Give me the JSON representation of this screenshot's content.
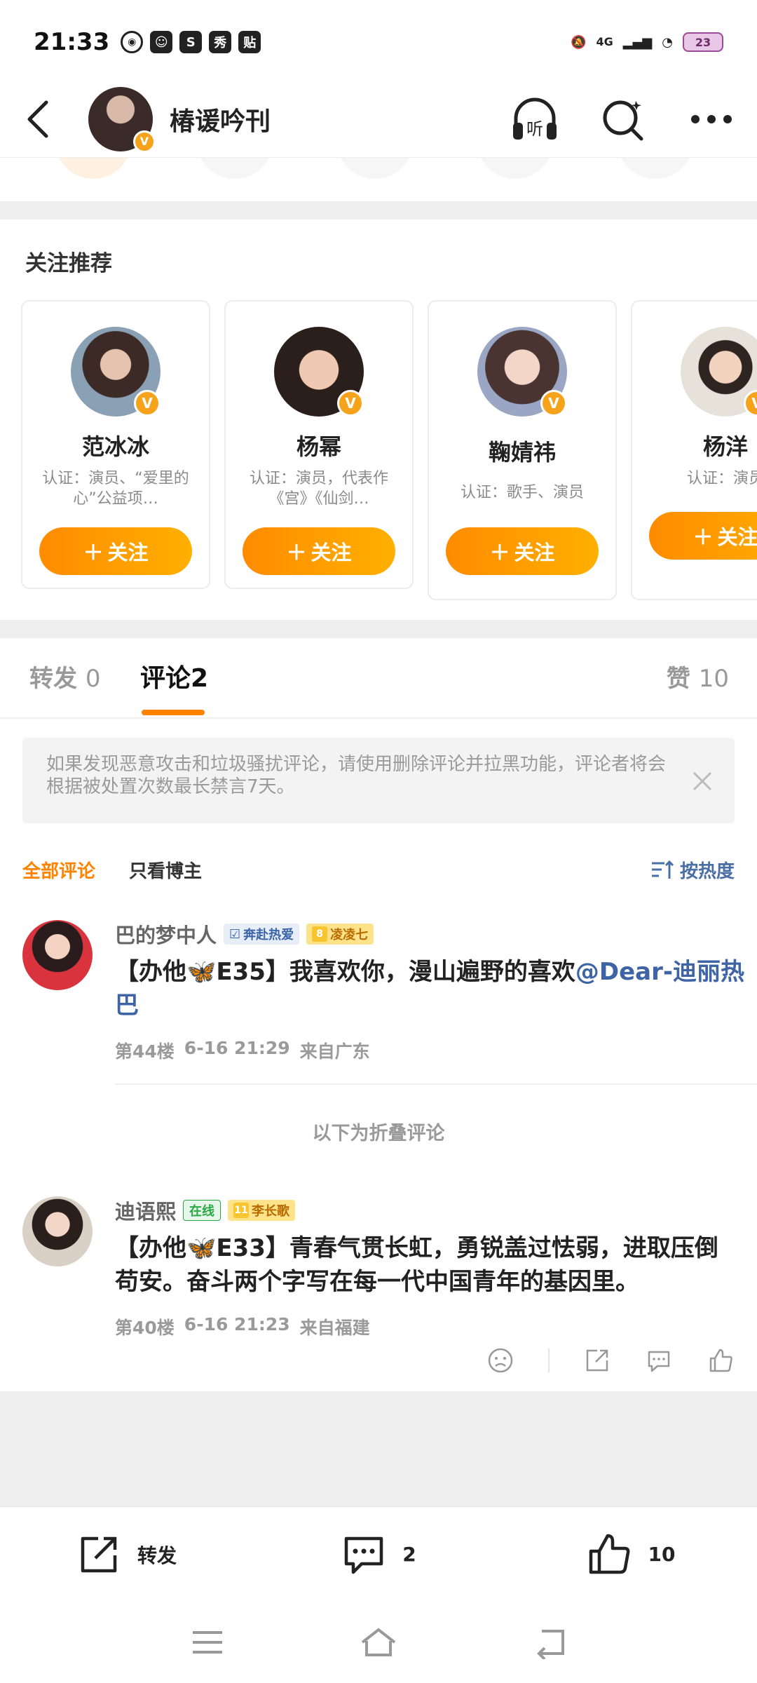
{
  "status_bar": {
    "time": "21:33",
    "app_icons": [
      "weibo-icon",
      "emoji-icon",
      "s-icon",
      "秀",
      "贴"
    ],
    "app_labels": {
      "xiu": "秀",
      "tie": "贴"
    },
    "network": "4G",
    "battery": "23"
  },
  "header": {
    "title": "椿谖吟刊",
    "listen_label": "听"
  },
  "recommend": {
    "title": "关注推荐",
    "follow_label": "关注",
    "cards": [
      {
        "name": "范冰冰",
        "desc": "认证：演员、“爱里的心”公益项…"
      },
      {
        "name": "杨幂",
        "desc": "认证：演员，代表作《宫》《仙剑…"
      },
      {
        "name": "鞠婧祎",
        "desc": "认证：歌手、演员"
      },
      {
        "name": "杨洋",
        "desc": "认证：演员"
      }
    ]
  },
  "tabs": {
    "repost": {
      "label": "转发",
      "count": "0"
    },
    "comment": {
      "label": "评论",
      "count": "2"
    },
    "like": {
      "label": "赞",
      "count": "10"
    }
  },
  "notice": {
    "text": "如果发现恶意攻击和垃圾骚扰评论，请使用删除评论并拉黑功能，评论者将会根据被处置次数最长禁言7天。"
  },
  "filters": {
    "all": "全部评论",
    "blogger_only": "只看博主",
    "sort": "按热度"
  },
  "comments": [
    {
      "user": "巴的梦中人",
      "tag1": "奔赴热爱",
      "tag2_level": "8",
      "tag2": "凌凌七",
      "text": "【办他🦋E35】我喜欢你，漫山遍野的喜欢",
      "mention": "@Dear-迪丽热巴",
      "floor": "第44楼",
      "time": "6-16 21:29",
      "location": "来自广东"
    },
    {
      "user": "迪语熙",
      "tag1": "在线",
      "tag2_level": "11",
      "tag2": "李长歌",
      "text": "【办他🦋E33】青春气贯长虹，勇锐盖过怯弱，进取压倒苟安。奋斗两个字写在每一代中国青年的基因里。",
      "floor": "第40楼",
      "time": "6-16 21:23",
      "location": "来自福建"
    }
  ],
  "folded_label": "以下为折叠评论",
  "bottom_bar": {
    "repost": "转发",
    "comment_count": "2",
    "like_count": "10"
  },
  "colors": {
    "accent": "#ff8200",
    "link": "#3e64a6",
    "vip_badge": "#f7a21b"
  }
}
